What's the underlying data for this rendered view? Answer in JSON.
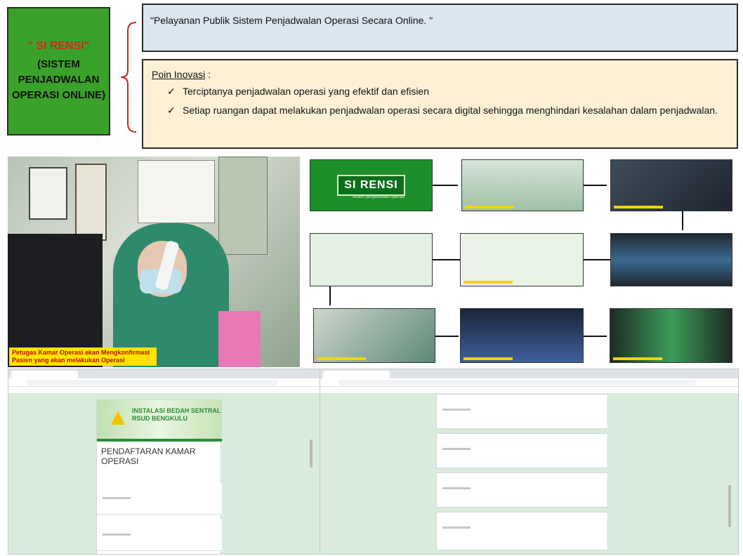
{
  "title_box": {
    "name": "\" SI RENSI\"",
    "line1": "(SISTEM",
    "line2": "PENJADWALAN",
    "line3": "OPERASI ONLINE)"
  },
  "quote": "\"Pelayanan Publik Sistem Penjadwalan Operasi Secara Online. \"",
  "poin": {
    "title": "Poin Inovasi",
    "title_suffix": " :",
    "items": [
      "Terciptanya penjadwalan operasi yang efektif dan efisien",
      "Setiap ruangan dapat melakukan penjadwalan operasi secara digital sehingga menghindari kesalahan dalam penjadwalan."
    ],
    "check_icon": "✓"
  },
  "photo_caption": "Petugas Kamar Operasi akan Mengkonfirmasi Pasien yang akan melakukan Operasi",
  "flow_logo": "SI RENSI",
  "flow_logo_tag": "sistem penjadwalan operasi",
  "browser_left": {
    "banner": "INSTALASI BEDAH SENTRAL RSUD BENGKULU",
    "heading": "PENDAFTARAN KAMAR OPERASI"
  },
  "colors": {
    "title_bg": "#3aa22b",
    "title_red": "#d9261c",
    "quote_bg": "#dce6f1",
    "poin_bg": "#fdf0d5",
    "brace": "#c0272d",
    "form_page_bg": "#d9ecdc"
  }
}
